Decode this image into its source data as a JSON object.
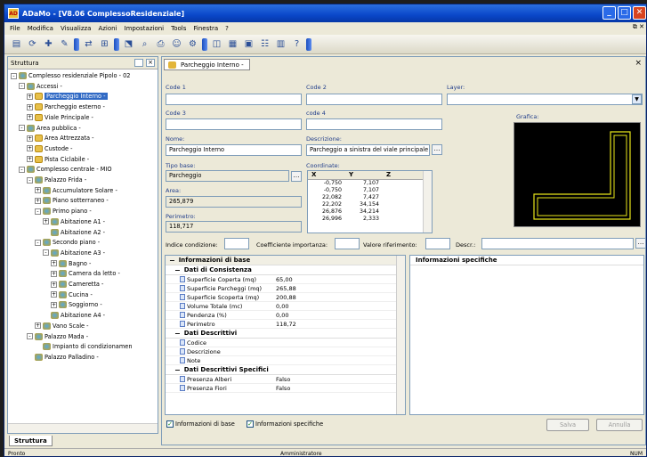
{
  "window": {
    "title": "ADaMo - [V8.06 ComplessoResidenziale]",
    "app_icon": "AD"
  },
  "menu": [
    "File",
    "Modifica",
    "Visualizza",
    "Azioni",
    "Impostazioni",
    "Tools",
    "Finestra",
    "?"
  ],
  "left_panel": {
    "title": "Struttura",
    "bottom_tab": "Struttura"
  },
  "tree": [
    {
      "label": "Complesso residenziale Pipolo - 02",
      "level": 0,
      "exp": "-",
      "icon": "net"
    },
    {
      "label": "Accessi -",
      "level": 1,
      "exp": "-",
      "icon": "net"
    },
    {
      "label": "Parcheggio Interno -",
      "level": 2,
      "exp": "+",
      "icon": "sub",
      "selected": true
    },
    {
      "label": "Parcheggio esterno -",
      "level": 2,
      "exp": "+",
      "icon": "sub"
    },
    {
      "label": "Viale Principale -",
      "level": 2,
      "exp": "+",
      "icon": "sub"
    },
    {
      "label": "Area pubblica -",
      "level": 1,
      "exp": "-",
      "icon": "net"
    },
    {
      "label": "Area Attrezzata -",
      "level": 2,
      "exp": "+",
      "icon": "sub"
    },
    {
      "label": "Custode -",
      "level": 2,
      "exp": "+",
      "icon": "sub"
    },
    {
      "label": "Pista Ciclabile -",
      "level": 2,
      "exp": "+",
      "icon": "sub"
    },
    {
      "label": "Complesso centrale - MIO",
      "level": 1,
      "exp": "-",
      "icon": "net"
    },
    {
      "label": "Palazzo Frida -",
      "level": 2,
      "exp": "-",
      "icon": "net"
    },
    {
      "label": "Accumulatore Solare -",
      "level": 3,
      "exp": "+",
      "icon": "net"
    },
    {
      "label": "Piano sotterraneo -",
      "level": 3,
      "exp": "+",
      "icon": "net"
    },
    {
      "label": "Primo piano -",
      "level": 3,
      "exp": "-",
      "icon": "net"
    },
    {
      "label": "Abitazione A1 -",
      "level": 4,
      "exp": "+",
      "icon": "net"
    },
    {
      "label": "Abitazione A2 -",
      "level": 4,
      "exp": "",
      "icon": "net"
    },
    {
      "label": "Secondo piano -",
      "level": 3,
      "exp": "-",
      "icon": "net"
    },
    {
      "label": "Abitazione A3 -",
      "level": 4,
      "exp": "-",
      "icon": "net"
    },
    {
      "label": "Bagno -",
      "level": 5,
      "exp": "+",
      "icon": "net"
    },
    {
      "label": "Camera da letto -",
      "level": 5,
      "exp": "+",
      "icon": "net"
    },
    {
      "label": "Cameretta -",
      "level": 5,
      "exp": "+",
      "icon": "net"
    },
    {
      "label": "Cucina -",
      "level": 5,
      "exp": "+",
      "icon": "net"
    },
    {
      "label": "Soggiorno -",
      "level": 5,
      "exp": "+",
      "icon": "net"
    },
    {
      "label": "Abitazione A4 -",
      "level": 4,
      "exp": "",
      "icon": "net"
    },
    {
      "label": "Vano Scale -",
      "level": 3,
      "exp": "+",
      "icon": "net"
    },
    {
      "label": "Palazzo Mada -",
      "level": 2,
      "exp": "-",
      "icon": "net"
    },
    {
      "label": "Impianto di condizionamen",
      "level": 3,
      "exp": "",
      "icon": "net"
    },
    {
      "label": "Palazzo Palladino -",
      "level": 2,
      "exp": "",
      "icon": "net"
    }
  ],
  "doc": {
    "tab_label": "Parcheggio Interno -",
    "labels": {
      "code1": "Code 1",
      "code2": "Code 2",
      "layer": "Layer:",
      "code3": "Code 3",
      "code4": "code 4",
      "grafica": "Grafica:",
      "nome": "Nome:",
      "descrizione": "Descrizione:",
      "tipo_base": "Tipo base:",
      "coordinate": "Coordinate:",
      "area": "Area:",
      "perimetro": "Perimetro:",
      "indice": "Indice condizione:",
      "coeff": "Coefficiente importanza:",
      "valore": "Valore riferimento:",
      "descr": "Descr.:"
    },
    "values": {
      "nome": "Parcheggio Interno",
      "descrizione": "Parcheggio a sinistra del viale principale",
      "tipo_base": "Parcheggio",
      "area": "265,879",
      "perimetro": "118,717"
    },
    "coord_headers": [
      "X",
      "Y",
      "Z"
    ],
    "coords": [
      [
        "-0,750",
        "7,107"
      ],
      [
        "-0,750",
        "7,107"
      ],
      [
        "22,082",
        "7,427"
      ],
      [
        "22,202",
        "34,154"
      ],
      [
        "26,876",
        "34,214"
      ],
      [
        "26,996",
        "2,333"
      ]
    ]
  },
  "props": {
    "root": "Informazioni di base",
    "groups": [
      {
        "title": "Dati di Consistenza",
        "rows": [
          [
            "Superficie Coperta (mq)",
            "65,00"
          ],
          [
            "Superficie Parcheggi (mq)",
            "265,88"
          ],
          [
            "Superficie Scoperta (mq)",
            "200,88"
          ],
          [
            "Volume Totale (mc)",
            "0,00"
          ],
          [
            "Pendenza (%)",
            "0,00"
          ],
          [
            "Perimetro",
            "118,72"
          ]
        ]
      },
      {
        "title": "Dati Descrittivi",
        "rows": [
          [
            "Codice",
            ""
          ],
          [
            "Descrizione",
            ""
          ],
          [
            "Note",
            ""
          ]
        ]
      },
      {
        "title": "Dati Descrittivi Specifici",
        "rows": [
          [
            "Presenza Alberi",
            "Falso"
          ],
          [
            "Presenza Fiori",
            "Falso"
          ]
        ]
      }
    ],
    "spec_title": "Informazioni specifiche"
  },
  "checks": {
    "base": "Informazioni di base",
    "spec": "Informazioni specifiche"
  },
  "buttons": {
    "salva": "Salva",
    "annulla": "Annulla"
  },
  "status": {
    "left": "Pronto",
    "mid": "Amministratore",
    "right": "NUM"
  },
  "colors": {
    "title": "#0a47c9",
    "selection": "#316ac5",
    "grafica_line": "#e8e61a"
  }
}
